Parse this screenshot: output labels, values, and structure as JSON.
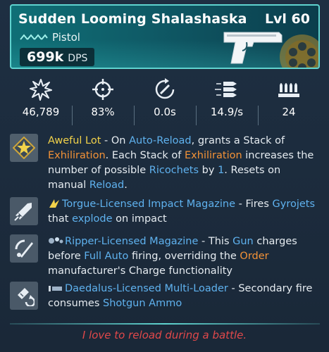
{
  "item": {
    "name": "Sudden Looming Shalashaska",
    "level": "Lvl 60",
    "type": "Pistol",
    "dps_value": "699k",
    "dps_label": "DPS",
    "rarity_color": "#5fd3cf"
  },
  "stats": [
    {
      "icon": "damage-burst-icon",
      "value": "46,789"
    },
    {
      "icon": "accuracy-crosshair-icon",
      "value": "83%"
    },
    {
      "icon": "reload-time-icon",
      "value": "0.0s"
    },
    {
      "icon": "fire-rate-bullets-icon",
      "value": "14.9/s"
    },
    {
      "icon": "magazine-ammo-icon",
      "value": "24"
    }
  ],
  "perks": [
    {
      "icon": "star-badge-icon",
      "segments": [
        {
          "t": "Aweful Lot",
          "c": "y"
        },
        {
          "t": " - On ",
          "c": ""
        },
        {
          "t": "Auto-Reload",
          "c": "b"
        },
        {
          "t": ", grants a Stack of ",
          "c": ""
        },
        {
          "t": "Exhiliration",
          "c": "o"
        },
        {
          "t": ". Each Stack of ",
          "c": ""
        },
        {
          "t": "Exhiliration",
          "c": "o"
        },
        {
          "t": " increases the number of possible ",
          "c": ""
        },
        {
          "t": "Ricochets",
          "c": "b"
        },
        {
          "t": " by ",
          "c": ""
        },
        {
          "t": "1",
          "c": "b"
        },
        {
          "t": ". Resets on manual ",
          "c": ""
        },
        {
          "t": "Reload",
          "c": "b"
        },
        {
          "t": ".",
          "c": ""
        }
      ]
    },
    {
      "icon": "rocket-magazine-icon",
      "segments": [
        {
          "t": "Torgue-Licensed Impact Magazine",
          "c": "b"
        },
        {
          "t": " - Fires ",
          "c": ""
        },
        {
          "t": "Gyrojets",
          "c": "b"
        },
        {
          "t": " that ",
          "c": ""
        },
        {
          "t": "explode",
          "c": "b"
        },
        {
          "t": " on impact",
          "c": ""
        }
      ]
    },
    {
      "icon": "ripper-magazine-icon",
      "segments": [
        {
          "t": "Ripper-Licensed Magazine",
          "c": "b"
        },
        {
          "t": " - This ",
          "c": ""
        },
        {
          "t": "Gun",
          "c": "b"
        },
        {
          "t": " charges before ",
          "c": ""
        },
        {
          "t": "Full Auto",
          "c": "b"
        },
        {
          "t": " firing, overriding the ",
          "c": ""
        },
        {
          "t": "Order",
          "c": "o"
        },
        {
          "t": " manufacturer's Charge functionality",
          "c": ""
        }
      ]
    },
    {
      "icon": "multi-loader-icon",
      "segments": [
        {
          "t": "Daedalus-Licensed Multi-Loader",
          "c": "b"
        },
        {
          "t": " - Secondary fire consumes ",
          "c": ""
        },
        {
          "t": "Shotgun Ammo",
          "c": "b"
        }
      ]
    }
  ],
  "flavor_text": "I love to reload during a battle.",
  "colors": {
    "highlight_yellow": "#f2d24a",
    "keyword_blue": "#5fb2ef",
    "keyword_orange": "#f39237",
    "flavor_red": "#e0484a"
  }
}
